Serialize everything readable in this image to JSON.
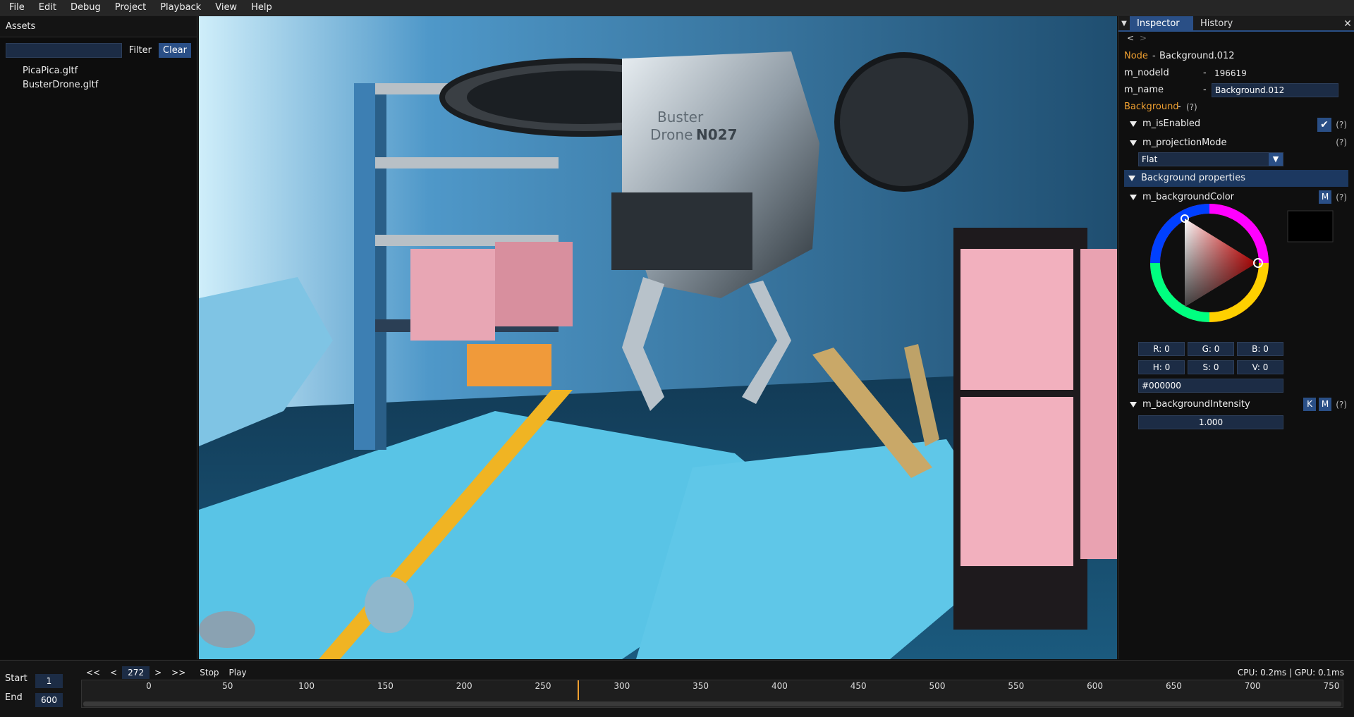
{
  "menu": [
    "File",
    "Edit",
    "Debug",
    "Project",
    "Playback",
    "View",
    "Help"
  ],
  "assets": {
    "title": "Assets",
    "filter_value": "",
    "filter_label": "Filter",
    "clear_label": "Clear",
    "items": [
      "PicaPica.gltf",
      "BusterDrone.gltf"
    ]
  },
  "viewport": {
    "drone_text_1": "Buster",
    "drone_text_2": "Drone",
    "drone_text_3": "N027"
  },
  "inspector": {
    "tabs": [
      "Inspector",
      "History"
    ],
    "nav_back": "<",
    "nav_forward": ">",
    "node_label": "Node",
    "node_sep": "-",
    "node_name": "Background.012",
    "node_id_label": "m_nodeId",
    "node_id_value": "196619",
    "name_label": "m_name",
    "name_value": "Background.012",
    "component_label": "Background",
    "help": "(?)",
    "is_enabled_label": "m_isEnabled",
    "projection_label": "m_projectionMode",
    "projection_value": "Flat",
    "bg_properties_label": "Background properties",
    "bg_color_label": "m_backgroundColor",
    "m_btn": "M",
    "k_btn": "K",
    "r": "R:  0",
    "g": "G:  0",
    "b": "B:  0",
    "h": "H:  0",
    "s": "S:  0",
    "v": "V:  0",
    "hex": "#000000",
    "intensity_label": "m_backgroundIntensity",
    "intensity_value": "1.000",
    "colors": {
      "accent": "#2a4f86",
      "orange": "#f0a030",
      "field": "#1c2c45"
    }
  },
  "timeline": {
    "start_label": "Start",
    "start_value": "1",
    "end_label": "End",
    "end_value": "600",
    "first": "<<",
    "prev": "<",
    "frame": "272",
    "next": ">",
    "last": ">>",
    "stop": "Stop",
    "play": "Play",
    "perf": "CPU: 0.2ms | GPU: 0.1ms",
    "ticks": [
      "0",
      "50",
      "100",
      "150",
      "200",
      "250",
      "300",
      "350",
      "400",
      "450",
      "500",
      "550",
      "600",
      "650",
      "700",
      "750"
    ],
    "current_frame": 272
  }
}
